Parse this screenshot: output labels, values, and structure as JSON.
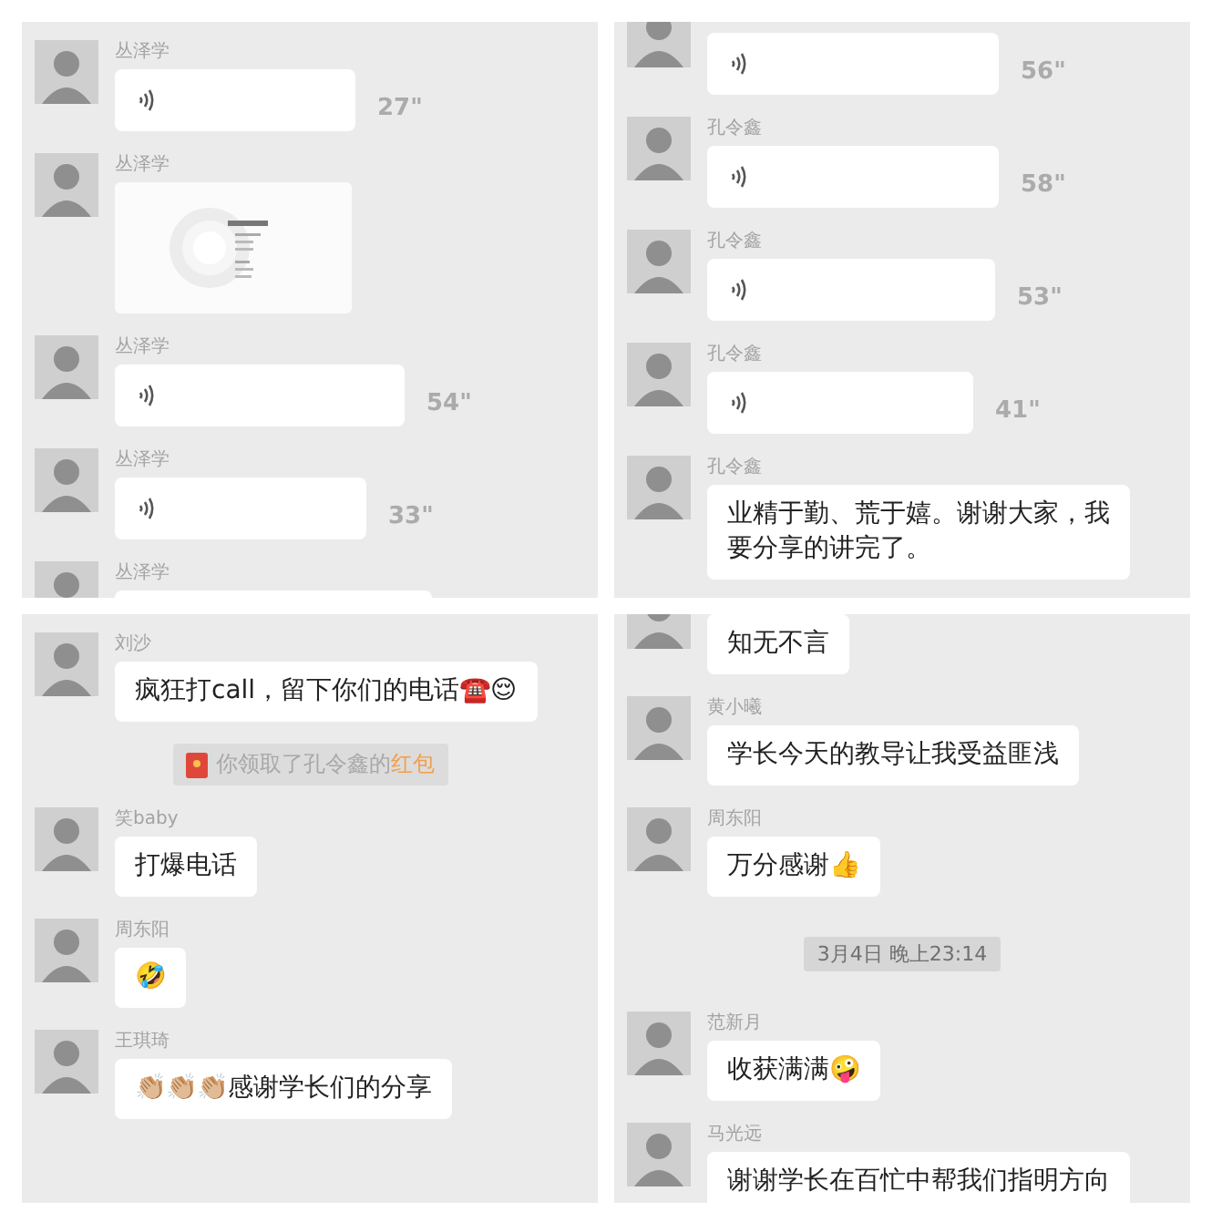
{
  "panels": [
    {
      "messages": [
        {
          "kind": "voice",
          "name": "丛泽学",
          "duration": "27\""
        },
        {
          "name": "丛泽学"
        },
        {
          "kind": "voice",
          "name": "丛泽学",
          "duration": "54\""
        },
        {
          "kind": "voice",
          "name": "丛泽学",
          "duration": "33\""
        },
        {
          "kind": "partial",
          "name": "丛泽学"
        }
      ]
    },
    {
      "messages": [
        {
          "kind": "voice",
          "duration": "56\""
        },
        {
          "kind": "voice",
          "name": "孔令鑫",
          "duration": "58\""
        },
        {
          "kind": "voice",
          "name": "孔令鑫",
          "duration": "53\""
        },
        {
          "kind": "voice",
          "name": "孔令鑫",
          "duration": "41\""
        },
        {
          "kind": "text",
          "name": "孔令鑫",
          "text": "业精于勤、荒于嬉。谢谢大家，我要分享的讲完了。"
        }
      ]
    },
    {
      "messages": [
        {
          "kind": "text",
          "name": "刘沙",
          "text": "疯狂打call，留下你们的电话☎️😌"
        },
        {
          "kind": "notice",
          "text": "你领取了孔令鑫的",
          "link": "红包"
        },
        {
          "kind": "text",
          "name": "笑baby",
          "text": "打爆电话"
        },
        {
          "kind": "text",
          "name": "周东阳",
          "text": "🤣"
        },
        {
          "kind": "text",
          "name": "王琪琦",
          "text": "👏🏼👏🏼👏🏼感谢学长们的分享"
        }
      ]
    },
    {
      "messages": [
        {
          "kind": "text",
          "text": "知无不言"
        },
        {
          "kind": "text",
          "name": "黄小曦",
          "text": "学长今天的教导让我受益匪浅"
        },
        {
          "kind": "text",
          "name": "周东阳",
          "text": "万分感谢👍"
        },
        {
          "kind": "time",
          "text": "3月4日 晚上23:14"
        },
        {
          "kind": "text",
          "name": "范新月",
          "text": "收获满满🤪"
        },
        {
          "kind": "text",
          "name": "马光远",
          "text": "谢谢学长在百忙中帮我们指明方向"
        }
      ]
    }
  ]
}
